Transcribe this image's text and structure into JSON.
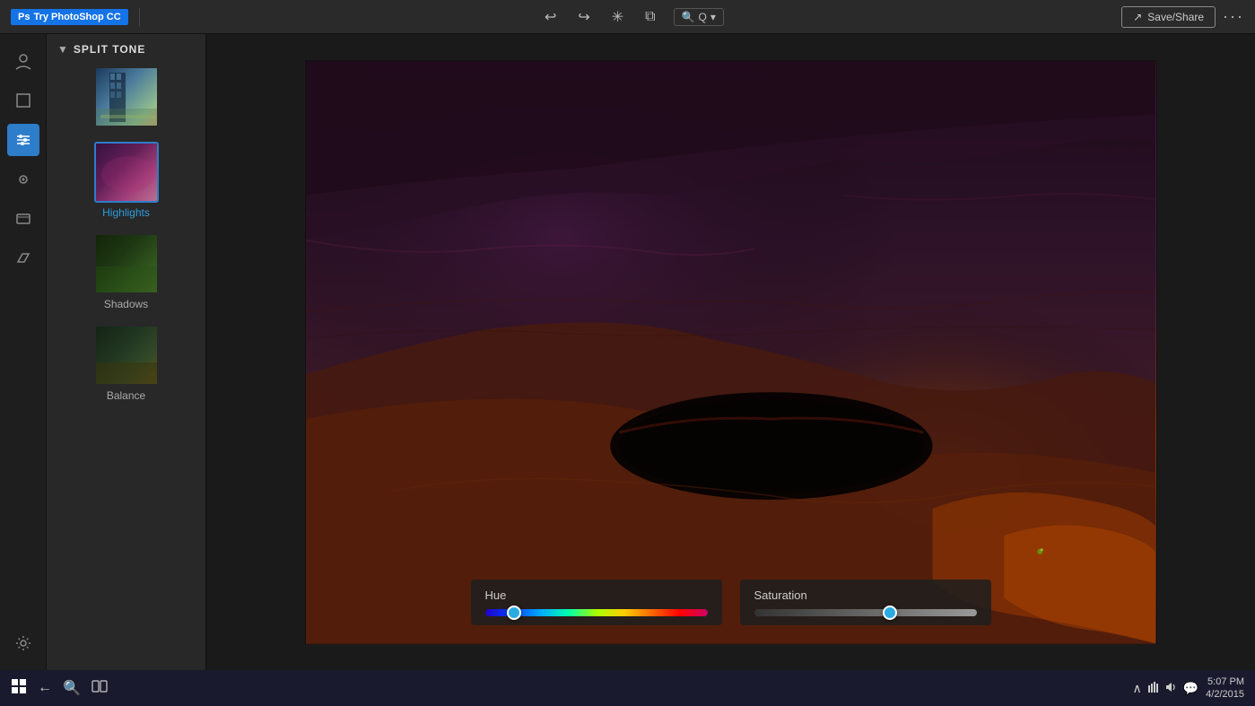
{
  "toolbar": {
    "ps_badge_label": "Ps",
    "ps_badge_text": "Try PhotoShop CC",
    "undo_title": "Undo",
    "redo_title": "Redo",
    "adjust_title": "Adjust",
    "compare_title": "Compare",
    "zoom_value": "Q",
    "zoom_arrow": "▾",
    "save_share_label": "Save/Share",
    "more_label": "···"
  },
  "icon_sidebar": {
    "icons": [
      {
        "name": "profile-icon",
        "symbol": "◉",
        "label": "Profile",
        "active": false
      },
      {
        "name": "crop-icon",
        "symbol": "⊡",
        "label": "Crop",
        "active": false
      },
      {
        "name": "adjust-icon",
        "symbol": "≡",
        "label": "Adjustments",
        "active": true
      },
      {
        "name": "eye-icon",
        "symbol": "◎",
        "label": "View",
        "active": false
      },
      {
        "name": "layers-icon",
        "symbol": "▭",
        "label": "Layers",
        "active": false
      },
      {
        "name": "erase-icon",
        "symbol": "◇",
        "label": "Erase",
        "active": false
      }
    ],
    "settings_icon": {
      "name": "settings-icon",
      "symbol": "⚙",
      "label": "Settings"
    }
  },
  "panel": {
    "section_label": "SPLIT TONE",
    "items": [
      {
        "id": "item-original",
        "label": "",
        "selected": false
      },
      {
        "id": "item-highlights",
        "label": "Highlights",
        "selected": true
      },
      {
        "id": "item-shadows",
        "label": "Shadows",
        "selected": false
      },
      {
        "id": "item-balance",
        "label": "Balance",
        "selected": false
      }
    ]
  },
  "hue_panel": {
    "label": "Hue",
    "thumb_position_percent": 12
  },
  "saturation_panel": {
    "label": "Saturation",
    "thumb_position_percent": 60
  },
  "taskbar": {
    "windows_symbol": "⊞",
    "back_symbol": "←",
    "search_symbol": "⌕",
    "task_view_symbol": "▣",
    "time": "5:07 PM",
    "date": "4/2/2015",
    "chevron": "∧",
    "network": "🌐",
    "speaker": "🔊",
    "notification": "≡"
  }
}
